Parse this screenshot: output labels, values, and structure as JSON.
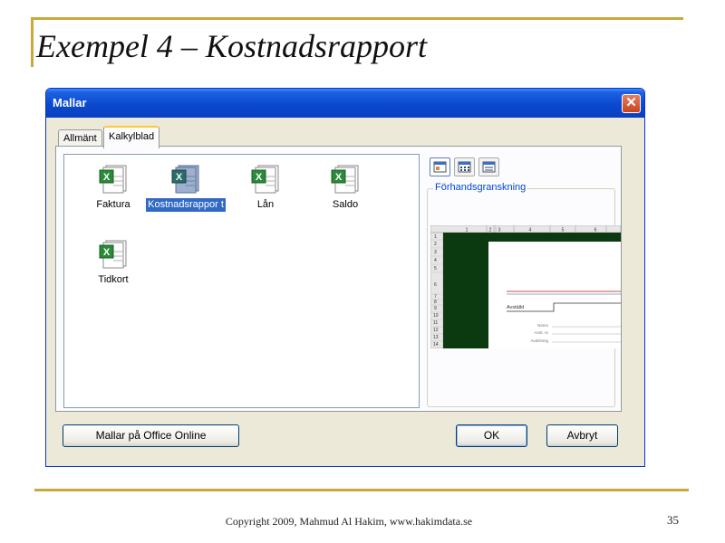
{
  "slide": {
    "title": "Exempel 4 – Kostnadsrapport",
    "footer": "Copyright 2009, Mahmud Al Hakim, www.hakimdata.se",
    "page_number": "35"
  },
  "dialog": {
    "title": "Mallar",
    "close_glyph": "✕",
    "tabs": [
      {
        "label": "Allmänt",
        "active": false
      },
      {
        "label": "Kalkylblad",
        "active": true
      }
    ],
    "templates": [
      {
        "name": "Faktura",
        "icon": "excel-template-icon",
        "selected": false
      },
      {
        "name": "Kostnadsrappor t",
        "icon": "excel-template-icon",
        "selected": true
      },
      {
        "name": "Lån",
        "icon": "excel-template-icon",
        "selected": false
      },
      {
        "name": "Saldo",
        "icon": "excel-template-icon",
        "selected": false
      },
      {
        "name": "Tidkort",
        "icon": "excel-template-icon",
        "selected": false
      }
    ],
    "view_buttons": [
      {
        "icon": "large-icons-view-icon",
        "active": true
      },
      {
        "icon": "list-view-icon",
        "active": false
      },
      {
        "icon": "details-view-icon",
        "active": false
      }
    ],
    "preview": {
      "label": "Förhandsgranskning",
      "columns": [
        "1",
        "2",
        "3",
        "4",
        "5",
        "6"
      ],
      "rows": [
        "1",
        "2",
        "3",
        "4",
        "5",
        "6",
        "7",
        "8",
        "9",
        "10",
        "11",
        "12",
        "13",
        "14"
      ],
      "field_label": "Avställd",
      "fields": [
        "Namn",
        "Anst. nr",
        "Avdelning"
      ]
    },
    "buttons": {
      "online": "Mallar på Office Online",
      "ok": "OK",
      "cancel": "Avbryt"
    }
  },
  "colors": {
    "titlebar": "#0a49cf",
    "selection": "#316ac5",
    "accent": "#c9a93a",
    "preview_dark": "#0b3a10"
  }
}
